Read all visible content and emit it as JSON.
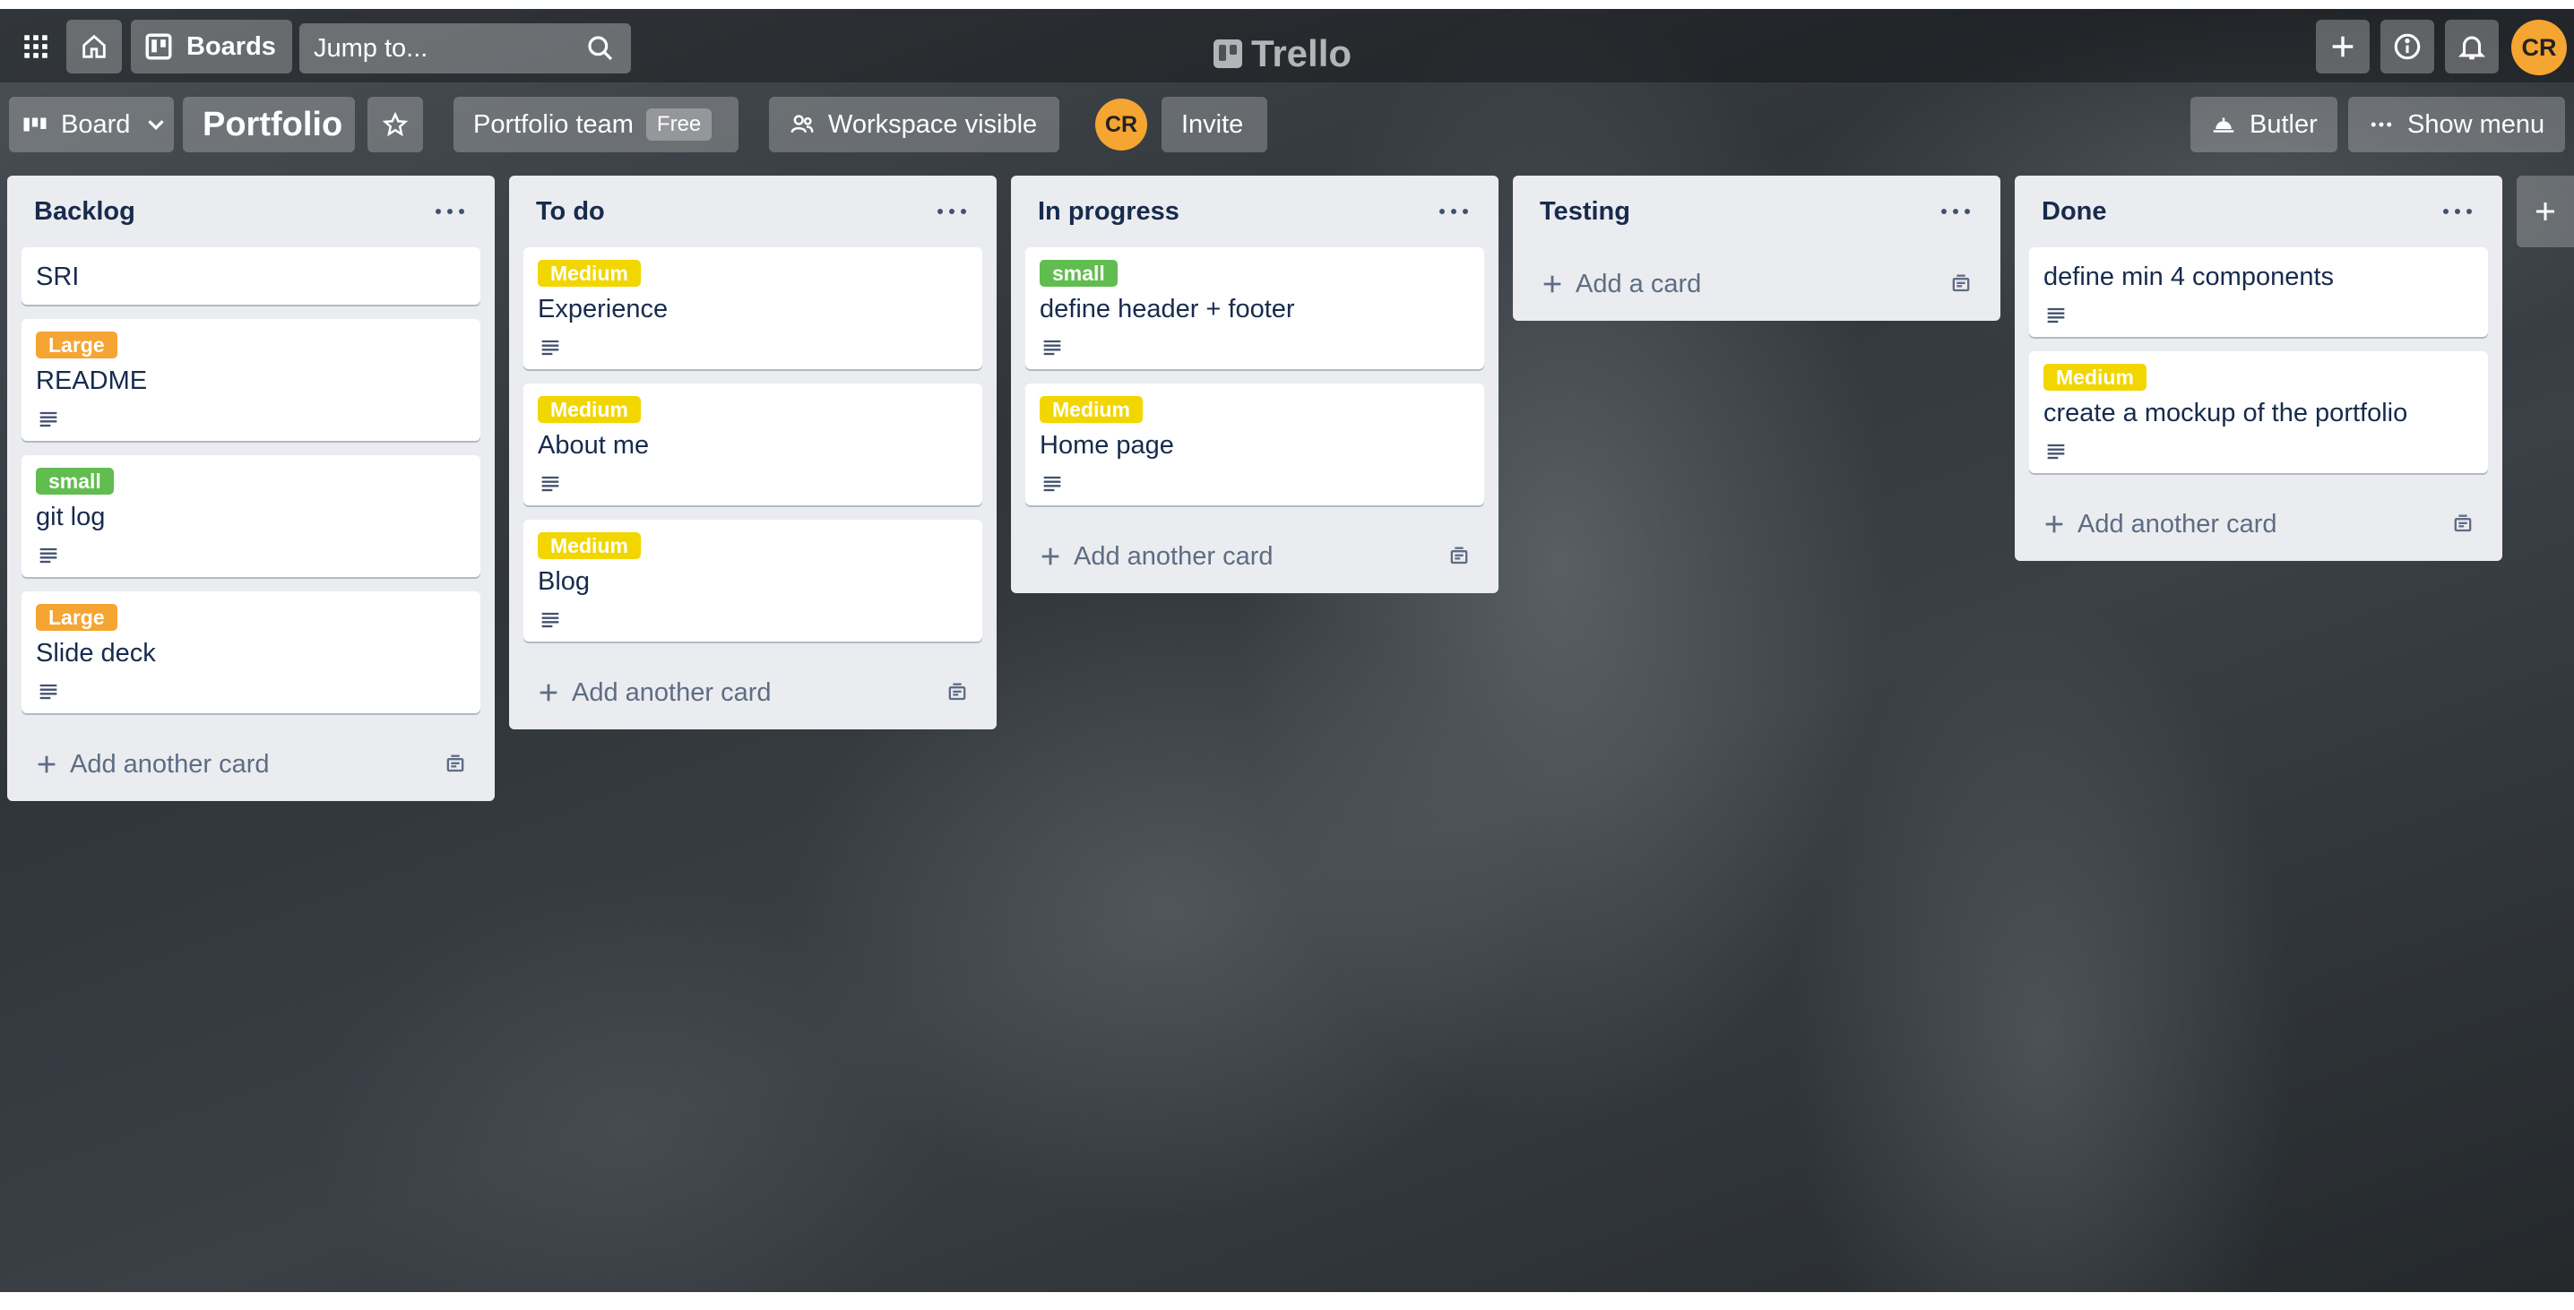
{
  "header": {
    "boards_label": "Boards",
    "search_placeholder": "Jump to...",
    "logo_text": "Trello",
    "user_initials": "CR"
  },
  "board": {
    "view_label": "Board",
    "title": "Portfolio",
    "workspace_name": "Portfolio team",
    "workspace_plan": "Free",
    "visibility_label": "Workspace visible",
    "member_initials": "CR",
    "invite_label": "Invite",
    "butler_label": "Butler",
    "show_menu_label": "Show menu"
  },
  "lists": [
    {
      "title": "Backlog",
      "add_label": "Add another card",
      "cards": [
        {
          "label": null,
          "title": "SRI",
          "has_description": false
        },
        {
          "label": {
            "text": "Large",
            "color": "#f5a532"
          },
          "title": "README",
          "has_description": true
        },
        {
          "label": {
            "text": "small",
            "color": "#61bd4f"
          },
          "title": "git log",
          "has_description": true
        },
        {
          "label": {
            "text": "Large",
            "color": "#f5a532"
          },
          "title": "Slide deck",
          "has_description": true
        }
      ]
    },
    {
      "title": "To do",
      "add_label": "Add another card",
      "cards": [
        {
          "label": {
            "text": "Medium",
            "color": "#f2d600"
          },
          "title": "Experience",
          "has_description": true
        },
        {
          "label": {
            "text": "Medium",
            "color": "#f2d600"
          },
          "title": "About me",
          "has_description": true
        },
        {
          "label": {
            "text": "Medium",
            "color": "#f2d600"
          },
          "title": "Blog",
          "has_description": true
        }
      ]
    },
    {
      "title": "In progress",
      "add_label": "Add another card",
      "cards": [
        {
          "label": {
            "text": "small",
            "color": "#61bd4f"
          },
          "title": "define header + footer",
          "has_description": true
        },
        {
          "label": {
            "text": "Medium",
            "color": "#f2d600"
          },
          "title": "Home page",
          "has_description": true
        }
      ]
    },
    {
      "title": "Testing",
      "add_label": "Add a card",
      "cards": []
    },
    {
      "title": "Done",
      "add_label": "Add another card",
      "cards": [
        {
          "label": null,
          "title": "define min 4 components",
          "has_description": true
        },
        {
          "label": {
            "text": "Medium",
            "color": "#f2d600"
          },
          "title": "create a mockup of the portfolio",
          "has_description": true
        }
      ]
    }
  ],
  "colors": {
    "accent_avatar": "#f5a532",
    "list_bg": "#ebecf0",
    "text_primary": "#172b4d"
  }
}
